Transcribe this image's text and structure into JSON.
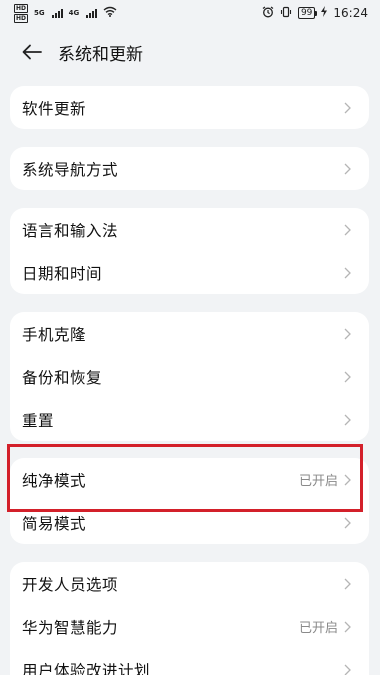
{
  "status_bar": {
    "sim1": "HD",
    "sim2": "HD",
    "net1": "5G",
    "net2": "4G",
    "battery": "99",
    "time": "16:24",
    "icons": [
      "wifi-icon",
      "alarm-icon",
      "vibrate-icon",
      "charging-icon"
    ]
  },
  "header": {
    "title": "系统和更新"
  },
  "groups": [
    {
      "items": [
        {
          "label": "软件更新"
        }
      ]
    },
    {
      "items": [
        {
          "label": "系统导航方式"
        }
      ]
    },
    {
      "items": [
        {
          "label": "语言和输入法"
        },
        {
          "label": "日期和时间"
        }
      ]
    },
    {
      "items": [
        {
          "label": "手机克隆"
        },
        {
          "label": "备份和恢复"
        },
        {
          "label": "重置"
        }
      ]
    },
    {
      "items": [
        {
          "label": "纯净模式",
          "value": "已开启"
        },
        {
          "label": "简易模式"
        }
      ]
    },
    {
      "items": [
        {
          "label": "开发人员选项"
        },
        {
          "label": "华为智慧能力",
          "value": "已开启"
        },
        {
          "label": "用户体验改进计划"
        }
      ]
    }
  ],
  "colors": {
    "background": "#f1f3f5",
    "card": "#ffffff",
    "highlight": "#d3202a",
    "secondary_text": "#8a8a8a"
  }
}
